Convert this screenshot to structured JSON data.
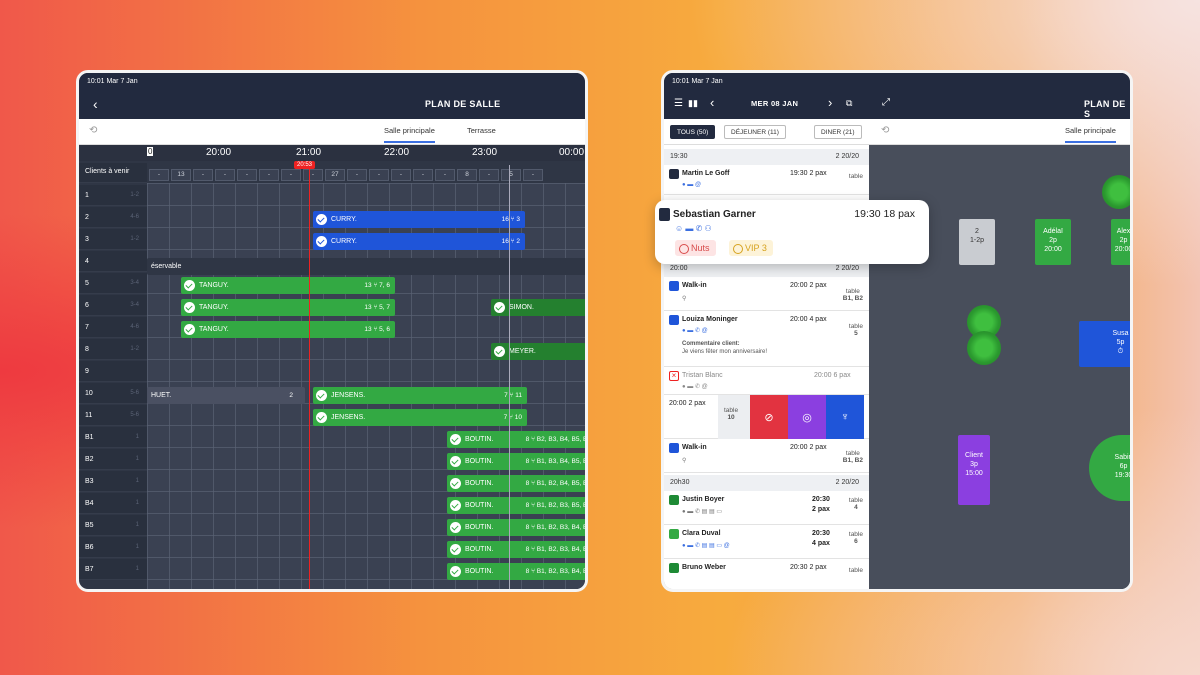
{
  "left_tablet": {
    "status": "10:01  Mar 7 Jan",
    "title": "PLAN DE SALLE",
    "tabs": [
      "Salle principale",
      "Terrasse"
    ],
    "clients_label": "Clients à venir",
    "times": [
      "20:00",
      "21:00",
      "22:00",
      "23:00",
      "00:00"
    ],
    "time_cut": "0",
    "now_label": "20:53",
    "counts": [
      "-",
      "13",
      "-",
      "-",
      "-",
      "-",
      "-",
      "-",
      "27",
      "-",
      "-",
      "-",
      "-",
      "-",
      "8",
      "-",
      "5",
      "-"
    ],
    "rows": [
      "1",
      "2",
      "3",
      "4",
      "5",
      "6",
      "7",
      "8",
      "9",
      "10",
      "11",
      "B1",
      "B2",
      "B3",
      "B4",
      "B5",
      "B6",
      "B7"
    ],
    "caps": [
      "1-2",
      "4-6",
      "1-2",
      "",
      "3-4",
      "3-4",
      "4-6",
      "1-2",
      "",
      "5-6",
      "5-6",
      "1",
      "1",
      "1",
      "1",
      "1",
      "1",
      "1"
    ],
    "reservable": "éservable",
    "bars": {
      "curry1": {
        "name": "CURRY.",
        "meta": "16  ⑂  3"
      },
      "curry2": {
        "name": "CURRY.",
        "meta": "16  ⑂  2"
      },
      "tanguy1": {
        "name": "TANGUY.",
        "meta": "13  ⑂  7, 6"
      },
      "tanguy2": {
        "name": "TANGUY.",
        "meta": "13  ⑂  5, 7"
      },
      "tanguy3": {
        "name": "TANGUY.",
        "meta": "13  ⑂  5, 6"
      },
      "simon": {
        "name": "SIMON."
      },
      "meyer": {
        "name": "MEYER."
      },
      "huet": {
        "name": "HUET.",
        "meta": "2"
      },
      "jensens1": {
        "name": "JENSENS.",
        "meta": "7  ⑂  11"
      },
      "jensens2": {
        "name": "JENSENS.",
        "meta": "7  ⑂  10"
      },
      "boutin": [
        {
          "name": "BOUTIN.",
          "meta": "8  ⑂  B2, B3, B4, B5, B6"
        },
        {
          "name": "BOUTIN.",
          "meta": "8  ⑂  B1, B3, B4, B5, B6"
        },
        {
          "name": "BOUTIN.",
          "meta": "8  ⑂  B1, B2, B4, B5, B6"
        },
        {
          "name": "BOUTIN.",
          "meta": "8  ⑂  B1, B2, B3, B5, B6"
        },
        {
          "name": "BOUTIN.",
          "meta": "8  ⑂  B1, B2, B3, B4, B6"
        },
        {
          "name": "BOUTIN.",
          "meta": "8  ⑂  B1, B2, B3, B4, B5"
        },
        {
          "name": "BOUTIN.",
          "meta": "8  ⑂  B1, B2, B3, B4, B5"
        }
      ]
    }
  },
  "right_tablet": {
    "status": "10:01  Mar 7 Jan",
    "date": "MER 08 JAN",
    "title": "PLAN DE S",
    "filters": [
      "TOUS (50)",
      "DÉJEUNER (11)",
      "DINER (21)"
    ],
    "map_tab": "Salle principale",
    "sections": [
      {
        "time": "19:30",
        "info": "2    20/20"
      },
      {
        "time": "20:00",
        "info": "2    20/20"
      },
      {
        "time": "20h30",
        "info": "2    20/20"
      }
    ],
    "reservations": {
      "goff": {
        "name": "Martin Le Goff",
        "time": "19:30 2 pax",
        "table": "table"
      },
      "walkin1": {
        "name": "Walk-in",
        "time": "20:00 2 pax",
        "table": "table",
        "table2": "B1, B2"
      },
      "louiza": {
        "name": "Louiza Moninger",
        "time": "20:00 4 pax",
        "table": "table",
        "table2": "5",
        "comment_title": "Commentaire client:",
        "comment": "Je viens fêter mon anniversaire!"
      },
      "tristan": {
        "name": "Tristan Blanc",
        "time": "20:00 6 pax"
      },
      "swipe": {
        "time": "20:00 2 pax",
        "table": "table",
        "table2": "10"
      },
      "walkin2": {
        "name": "Walk-in",
        "time": "20:00 2 pax",
        "table": "table",
        "table2": "B1, B2"
      },
      "justin": {
        "name": "Justin Boyer",
        "time": "20:30",
        "pax": "2 pax",
        "table": "table",
        "table2": "4"
      },
      "clara": {
        "name": "Clara Duval",
        "time": "20:30",
        "pax": "4 pax",
        "table": "table",
        "table2": "6"
      },
      "bruno": {
        "name": "Bruno Weber",
        "time": "20:30 2 pax",
        "table": "table"
      }
    },
    "popup": {
      "name": "Sebastian Garner",
      "time": "19:30 18 pax",
      "tags": [
        "Nuts",
        "VIP 3"
      ]
    },
    "tables": [
      {
        "l1": "2",
        "l2": "1-2p",
        "color": "#c9ccd1"
      },
      {
        "l1": "Adélaï",
        "l2": "2p",
        "l3": "20:00",
        "color": "#33a943"
      },
      {
        "l1": "Alex",
        "l2": "2p",
        "l3": "20:00",
        "color": "#33a943"
      },
      {
        "l1": "Susa",
        "l2": "5p",
        "color": "#1f55d9"
      },
      {
        "l1": "Client",
        "l2": "3p",
        "l3": "15:00",
        "color": "#8b3fe0"
      },
      {
        "l1": "Sabin",
        "l2": "6p",
        "l3": "19:30",
        "color": "#33a943"
      }
    ]
  },
  "colors": {
    "navy": "#222a3f",
    "green": "#33a943",
    "blue": "#1f55d9",
    "red": "#e22222",
    "purple": "#8b3fe0"
  }
}
